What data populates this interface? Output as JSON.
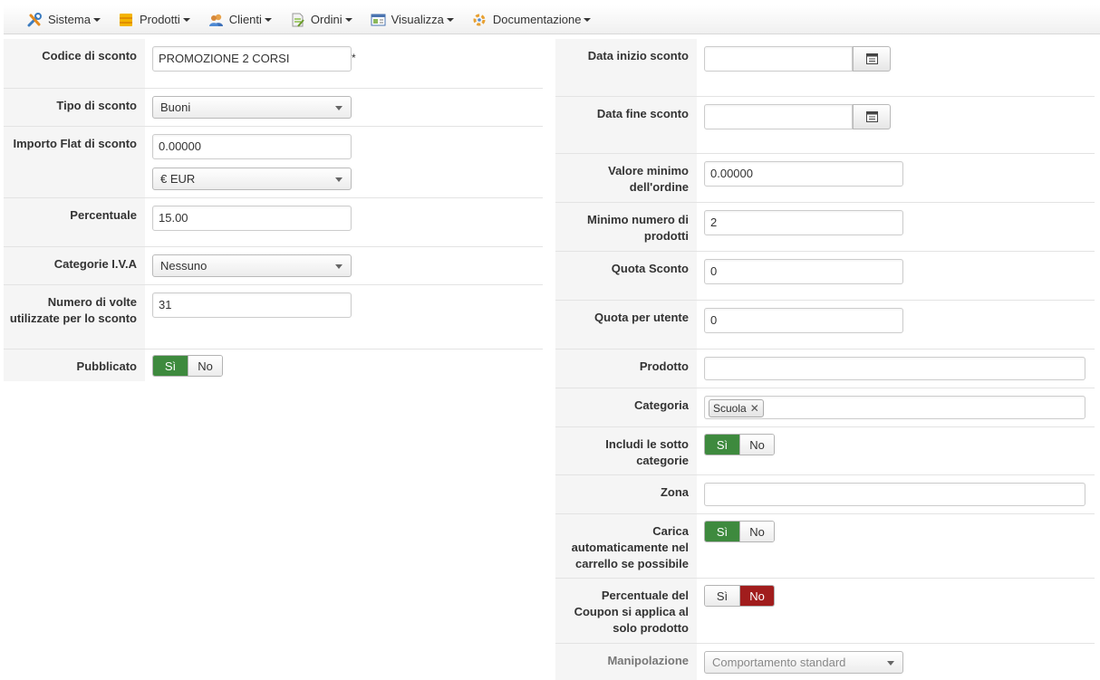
{
  "menu": {
    "items": [
      {
        "label": "Sistema",
        "icon": "tools-icon"
      },
      {
        "label": "Prodotti",
        "icon": "products-icon"
      },
      {
        "label": "Clienti",
        "icon": "users-icon"
      },
      {
        "label": "Ordini",
        "icon": "orders-icon"
      },
      {
        "label": "Visualizza",
        "icon": "view-icon"
      },
      {
        "label": "Documentazione",
        "icon": "documentation-icon"
      }
    ]
  },
  "left": {
    "code_label": "Codice di sconto",
    "code_value": "PROMOZIONE 2 CORSI",
    "required_mark": "*",
    "type_label": "Tipo di sconto",
    "type_value": "Buoni",
    "flat_label": "Importo Flat di sconto",
    "flat_value": "0.00000",
    "currency_value": "€ EUR",
    "percent_label": "Percentuale",
    "percent_value": "15.00",
    "vat_label": "Categorie I.V.A",
    "vat_value": "Nessuno",
    "uses_label": "Numero di volte utilizzate per lo sconto",
    "uses_value": "31",
    "published_label": "Pubblicato",
    "yes": "Sì",
    "no": "No"
  },
  "right": {
    "start_label": "Data inizio sconto",
    "start_value": "",
    "end_label": "Data fine sconto",
    "end_value": "",
    "min_order_label": "Valore minimo dell'ordine",
    "min_order_value": "0.00000",
    "min_products_label": "Minimo numero di prodotti",
    "min_products_value": "2",
    "quota_label": "Quota Sconto",
    "quota_value": "0",
    "quota_user_label": "Quota per utente",
    "quota_user_value": "0",
    "product_label": "Prodotto",
    "product_value": "",
    "category_label": "Categoria",
    "category_tag": "Scuola",
    "subcat_label": "Includi le sotto categorie",
    "zone_label": "Zona",
    "zone_value": "",
    "autoload_label": "Carica automaticamente nel carrello se possibile",
    "coupon_pct_label": "Percentuale del Coupon si applica al solo prodotto",
    "manip_label": "Manipolazione",
    "manip_value": "Comportamento standard",
    "yes": "Sì",
    "no": "No"
  }
}
